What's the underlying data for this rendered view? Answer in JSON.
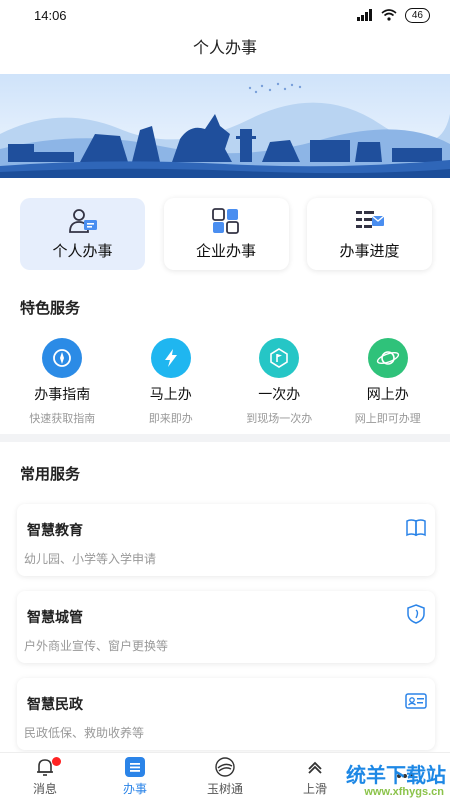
{
  "status": {
    "time": "14:06",
    "battery": "46"
  },
  "nav": {
    "title": "个人办事"
  },
  "quick_tabs": [
    {
      "label": "个人办事",
      "icon": "person-card-icon",
      "active": true
    },
    {
      "label": "企业办事",
      "icon": "grid-apps-icon",
      "active": false
    },
    {
      "label": "办事进度",
      "icon": "progress-mail-icon",
      "active": false
    }
  ],
  "featured": {
    "title": "特色服务",
    "items": [
      {
        "title": "办事指南",
        "subtitle": "快速获取指南",
        "icon": "compass-icon",
        "color": "#2b8be6"
      },
      {
        "title": "马上办",
        "subtitle": "即来即办",
        "icon": "lightning-icon",
        "color": "#1fb6f0"
      },
      {
        "title": "一次办",
        "subtitle": "到现场一次办",
        "icon": "flag-icon",
        "color": "#25c6c6"
      },
      {
        "title": "网上办",
        "subtitle": "网上即可办理",
        "icon": "planet-icon",
        "color": "#2fc27a"
      }
    ]
  },
  "common": {
    "title": "常用服务",
    "items": [
      {
        "title": "智慧教育",
        "subtitle": "幼儿园、小学等入学申请",
        "icon": "book-icon"
      },
      {
        "title": "智慧城管",
        "subtitle": "户外商业宣传、窗户更换等",
        "icon": "shield-icon"
      },
      {
        "title": "智慧民政",
        "subtitle": "民政低保、救助收养等",
        "icon": "id-card-icon"
      }
    ]
  },
  "tabbar": [
    {
      "label": "消息",
      "icon": "bell-icon",
      "active": false,
      "badge": true
    },
    {
      "label": "办事",
      "icon": "menu-icon",
      "active": true
    },
    {
      "label": "玉树通",
      "icon": "emblem-icon",
      "active": false
    },
    {
      "label": "上滑",
      "icon": "chevron-up-icon",
      "active": false
    },
    {
      "label": "",
      "icon": "more-icon",
      "active": false
    }
  ],
  "colors": {
    "accent": "#2b84e8",
    "banner_sky": "#dfeefc",
    "badge": "#ff2222"
  },
  "watermark": {
    "text": "统羊下载站",
    "url": "www.xfhygs.cn"
  }
}
